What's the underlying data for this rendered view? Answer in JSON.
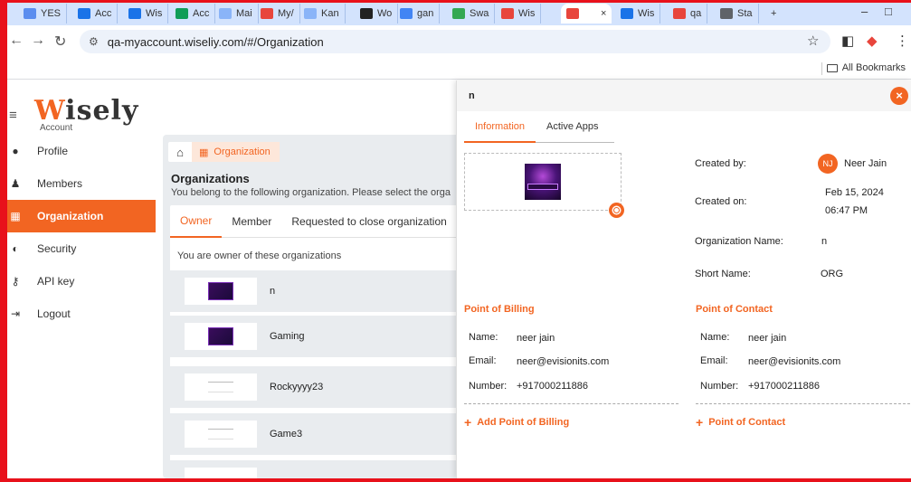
{
  "browser": {
    "tabs": [
      {
        "label": "YES",
        "color": "#5b8def"
      },
      {
        "label": "Acc",
        "color": "#1a73e8"
      },
      {
        "label": "Wis",
        "color": "#1a73e8"
      },
      {
        "label": "Acc",
        "color": "#0f9d58"
      },
      {
        "label": "Mai",
        "color": "#8ab4f8"
      },
      {
        "label": "My/",
        "color": "#e8453c"
      },
      {
        "label": "Kan",
        "color": "#8ab4f8"
      },
      {
        "label": "Wo",
        "color": "#222222"
      },
      {
        "label": "gan",
        "color": "#4285f4"
      },
      {
        "label": "Swa",
        "color": "#34a853"
      },
      {
        "label": "Wis",
        "color": "#e8453c"
      },
      {
        "label": "",
        "color": "#e8453c"
      },
      {
        "label": "Wis",
        "color": "#1a73e8"
      },
      {
        "label": "qa",
        "color": "#e8453c"
      },
      {
        "label": "Sta",
        "color": "#5f6368"
      }
    ],
    "active_tab_close": "×",
    "new_tab": "+",
    "url": "qa-myaccount.wiseliy.com/#/Organization",
    "bookmarks_label": "All Bookmarks"
  },
  "brand": {
    "logo_text": "Wisely",
    "logo_sub": "Account"
  },
  "sidebar": {
    "items": [
      {
        "label": "Profile",
        "icon": "user-circle-icon",
        "glyph": "●"
      },
      {
        "label": "Members",
        "icon": "users-icon",
        "glyph": "♟"
      },
      {
        "label": "Organization",
        "icon": "building-icon",
        "glyph": "▦"
      },
      {
        "label": "Security",
        "icon": "shield-icon",
        "glyph": "◐"
      },
      {
        "label": "API key",
        "icon": "key-icon",
        "glyph": "⚷"
      },
      {
        "label": "Logout",
        "icon": "logout-icon",
        "glyph": "⇥"
      }
    ],
    "active_index": 2
  },
  "main": {
    "breadcrumb_current": "Organization",
    "title": "Organizations",
    "subtitle": "You belong to the following organization. Please select the orga",
    "tabs": [
      "Owner",
      "Member",
      "Requested to close organization"
    ],
    "active_tab": 0,
    "owner_note": "You are owner of these organizations",
    "organizations": [
      {
        "name": "n",
        "thumb": "gaming"
      },
      {
        "name": "Gaming",
        "thumb": "gaming"
      },
      {
        "name": "Rockyyyy23",
        "thumb": "wisely"
      },
      {
        "name": "Game3",
        "thumb": "wisely"
      }
    ]
  },
  "panel": {
    "title": "n",
    "close_glyph": "×",
    "tabs": [
      "Information",
      "Active Apps"
    ],
    "active_tab": 0,
    "created_by_label": "Created by:",
    "created_by_initials": "NJ",
    "created_by_name": "Neer Jain",
    "created_on_label": "Created on:",
    "created_on_date": "Feb 15, 2024",
    "created_on_time": "06:47 PM",
    "org_name_label": "Organization Name:",
    "org_name_value": "n",
    "short_name_label": "Short Name:",
    "short_name_value": "ORG",
    "billing": {
      "title": "Point of Billing",
      "name_label": "Name:",
      "name": "neer jain",
      "email_label": "Email:",
      "email": "neer@evisionits.com",
      "number_label": "Number:",
      "number": "+917000211886",
      "add_label": "Add Point of Billing"
    },
    "contact": {
      "title": "Point of Contact",
      "name_label": "Name:",
      "name": "neer jain",
      "email_label": "Email:",
      "email": "neer@evisionits.com",
      "number_label": "Number:",
      "number": "+917000211886",
      "add_label": "Point of Contact"
    }
  },
  "colors": {
    "accent": "#f26522",
    "frame": "#e8111b"
  }
}
